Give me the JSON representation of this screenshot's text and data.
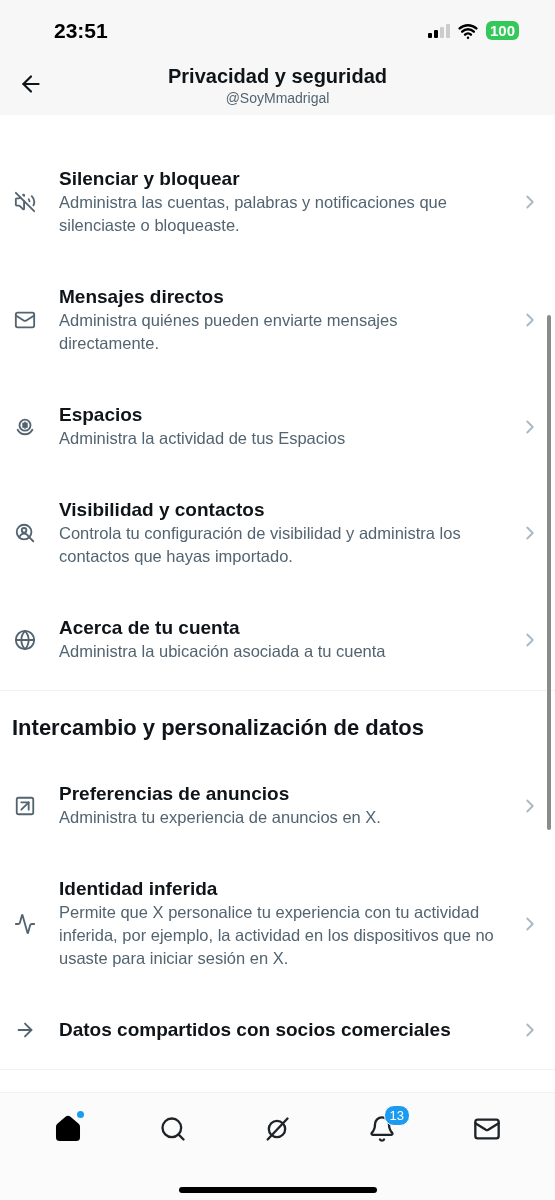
{
  "status_bar": {
    "time": "23:51",
    "battery": "100"
  },
  "header": {
    "title": "Privacidad y seguridad",
    "handle": "@SoyMmadrigal"
  },
  "sections": [
    {
      "items": [
        {
          "kind": "mute",
          "title": "Silenciar y bloquear",
          "description": "Administra las cuentas, palabras y notificaciones que silenciaste o bloqueaste."
        },
        {
          "kind": "mail",
          "title": "Mensajes directos",
          "description": "Administra quiénes pueden enviarte mensajes directamente."
        },
        {
          "kind": "spaces",
          "title": "Espacios",
          "description": "Administra la actividad de tus Espacios"
        },
        {
          "kind": "visibility",
          "title": "Visibilidad y contactos",
          "description": "Controla tu configuración de visibilidad y administra los contactos que hayas importado."
        },
        {
          "kind": "globe",
          "title": "Acerca de tu cuenta",
          "description": "Administra la ubicación asociada a tu cuenta"
        }
      ]
    },
    {
      "heading": "Intercambio y personalización de datos",
      "items": [
        {
          "kind": "ads",
          "title": "Preferencias de anuncios",
          "description": "Administra tu experiencia de anuncios en X."
        },
        {
          "kind": "activity",
          "title": "Identidad inferida",
          "description": "Permite que X personalice tu experiencia con tu actividad inferida, por ejemplo, la actividad en los dispositivos que no usaste para iniciar sesión en X."
        },
        {
          "kind": "share",
          "title": "Datos compartidos con socios comerciales"
        }
      ]
    }
  ],
  "nav": [
    {
      "kind": "home",
      "selected": true,
      "dot": true
    },
    {
      "kind": "search",
      "selected": false,
      "dot": false
    },
    {
      "kind": "grok",
      "selected": false,
      "dot": false
    },
    {
      "kind": "bell",
      "selected": false,
      "dot": false,
      "badge": "13"
    },
    {
      "kind": "mail",
      "selected": false,
      "dot": false
    }
  ]
}
